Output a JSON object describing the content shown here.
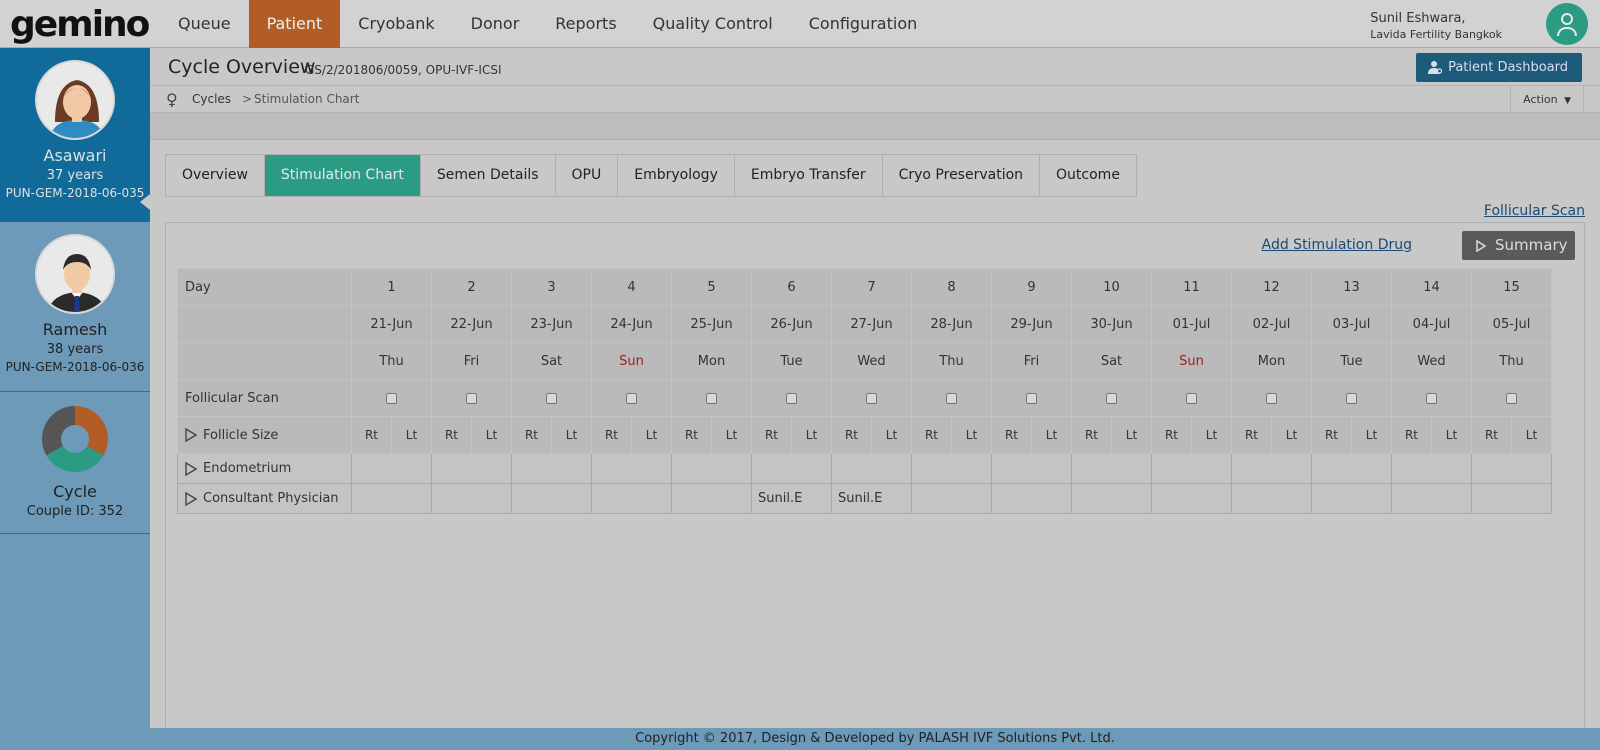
{
  "app": {
    "logo": "gemino"
  },
  "nav": {
    "items": [
      {
        "label": "Queue",
        "active": false
      },
      {
        "label": "Patient",
        "active": true
      },
      {
        "label": "Cryobank",
        "active": false
      },
      {
        "label": "Donor",
        "active": false
      },
      {
        "label": "Reports",
        "active": false
      },
      {
        "label": "Quality Control",
        "active": false
      },
      {
        "label": "Configuration",
        "active": false
      }
    ]
  },
  "user": {
    "name": "Sunil Eshwara,",
    "org": "Lavida Fertility Bangkok"
  },
  "sidebar": {
    "female": {
      "name": "Asawari",
      "age": "37 years",
      "id": "PUN-GEM-2018-06-035"
    },
    "male": {
      "name": "Ramesh",
      "age": "38 years",
      "id": "PUN-GEM-2018-06-036"
    },
    "cycle": {
      "title": "Cycle",
      "couple": "Couple ID: 352"
    }
  },
  "header": {
    "title": "Cycle Overview",
    "subtitle": "GS/2/201806/0059, OPU-IVF-ICSI",
    "dashboard_button": "Patient Dashboard"
  },
  "breadcrumb": {
    "root": "Cycles",
    "separator": ">",
    "current": "Stimulation Chart",
    "action": "Action"
  },
  "tabs": [
    {
      "label": "Overview",
      "active": false
    },
    {
      "label": "Stimulation Chart",
      "active": true
    },
    {
      "label": "Semen Details",
      "active": false
    },
    {
      "label": "OPU",
      "active": false
    },
    {
      "label": "Embryology",
      "active": false
    },
    {
      "label": "Embryo Transfer",
      "active": false
    },
    {
      "label": "Cryo Preservation",
      "active": false
    },
    {
      "label": "Outcome",
      "active": false
    }
  ],
  "links": {
    "follicular_scan": "Follicular Scan",
    "add_drug": "Add Stimulation Drug",
    "summary": "Summary"
  },
  "chart": {
    "labels": {
      "day": "Day",
      "follicular_scan": "Follicular Scan",
      "follicle_size": "Follicle Size",
      "endometrium": "Endometrium",
      "consultant": "Consultant Physician",
      "rt": "Rt",
      "lt": "Lt"
    },
    "days": [
      {
        "n": "1",
        "date": "21-Jun",
        "dow": "Thu",
        "sun": false,
        "physician": ""
      },
      {
        "n": "2",
        "date": "22-Jun",
        "dow": "Fri",
        "sun": false,
        "physician": ""
      },
      {
        "n": "3",
        "date": "23-Jun",
        "dow": "Sat",
        "sun": false,
        "physician": ""
      },
      {
        "n": "4",
        "date": "24-Jun",
        "dow": "Sun",
        "sun": true,
        "physician": ""
      },
      {
        "n": "5",
        "date": "25-Jun",
        "dow": "Mon",
        "sun": false,
        "physician": ""
      },
      {
        "n": "6",
        "date": "26-Jun",
        "dow": "Tue",
        "sun": false,
        "physician": "Sunil.E"
      },
      {
        "n": "7",
        "date": "27-Jun",
        "dow": "Wed",
        "sun": false,
        "physician": "Sunil.E"
      },
      {
        "n": "8",
        "date": "28-Jun",
        "dow": "Thu",
        "sun": false,
        "physician": ""
      },
      {
        "n": "9",
        "date": "29-Jun",
        "dow": "Fri",
        "sun": false,
        "physician": ""
      },
      {
        "n": "10",
        "date": "30-Jun",
        "dow": "Sat",
        "sun": false,
        "physician": ""
      },
      {
        "n": "11",
        "date": "01-Jul",
        "dow": "Sun",
        "sun": true,
        "physician": ""
      },
      {
        "n": "12",
        "date": "02-Jul",
        "dow": "Mon",
        "sun": false,
        "physician": ""
      },
      {
        "n": "13",
        "date": "03-Jul",
        "dow": "Tue",
        "sun": false,
        "physician": ""
      },
      {
        "n": "14",
        "date": "04-Jul",
        "dow": "Wed",
        "sun": false,
        "physician": ""
      },
      {
        "n": "15",
        "date": "05-Jul",
        "dow": "Thu",
        "sun": false,
        "physician": ""
      }
    ]
  },
  "footer": {
    "text": "Copyright © 2017, Design & Developed by PALASH IVF Solutions Pvt. Ltd."
  },
  "colors": {
    "accent": "#2b9b83",
    "nav_active": "#b35d26",
    "sidebar": "#6d9ab9",
    "sidebar_active": "#106a9a",
    "sunday": "#a12020"
  }
}
